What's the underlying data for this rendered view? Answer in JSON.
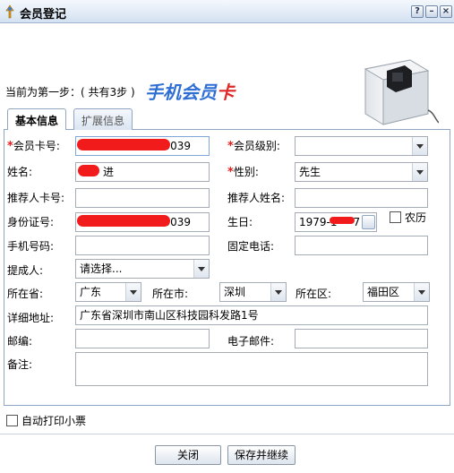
{
  "window": {
    "title": "会员登记",
    "help_label": "?",
    "minimize_label": "–",
    "close_label": "×"
  },
  "header": {
    "step_text": "当前为第一步：( 共有3步 )",
    "logo_main": "手机会员",
    "logo_accent": "卡"
  },
  "tabs": [
    {
      "label": "基本信息",
      "active": true
    },
    {
      "label": "扩展信息",
      "active": false
    }
  ],
  "form": {
    "card_no": {
      "label": "会员卡号:",
      "required": "*",
      "value": "0039"
    },
    "level": {
      "label": "会员级别:",
      "required": "*",
      "value": ""
    },
    "name": {
      "label": "姓名:",
      "value": "进"
    },
    "gender": {
      "label": "性别:",
      "required": "*",
      "value": "先生"
    },
    "ref_card": {
      "label": "推荐人卡号:",
      "value": ""
    },
    "ref_name": {
      "label": "推荐人姓名:",
      "value": ""
    },
    "id_no": {
      "label": "身份证号:",
      "value": "0039"
    },
    "birthday": {
      "label": "生日:",
      "value": "1979-1",
      "value_tail": "7"
    },
    "lunar": {
      "label": "农历",
      "checked": false
    },
    "mobile": {
      "label": "手机号码:",
      "value": ""
    },
    "phone": {
      "label": "固定电话:",
      "value": ""
    },
    "referrer": {
      "label": "提成人:",
      "value": "请选择..."
    },
    "province": {
      "label": "所在省:",
      "value": "广东"
    },
    "city": {
      "label": "所在市:",
      "value": "深圳"
    },
    "district": {
      "label": "所在区:",
      "value": "福田区"
    },
    "address": {
      "label": "详细地址:",
      "value": "广东省深圳市南山区科技园科发路1号"
    },
    "zip": {
      "label": "邮编:",
      "value": ""
    },
    "email": {
      "label": "电子邮件:",
      "value": ""
    },
    "note": {
      "label": "备注:",
      "value": ""
    }
  },
  "auto_print": {
    "label": "自动打印小票",
    "checked": false
  },
  "buttons": {
    "close": "关闭",
    "save_continue": "保存并继续"
  },
  "colors": {
    "accent_blue": "#2f6fd3",
    "required_red": "#e02020",
    "redaction_red": "#f21b1b"
  }
}
